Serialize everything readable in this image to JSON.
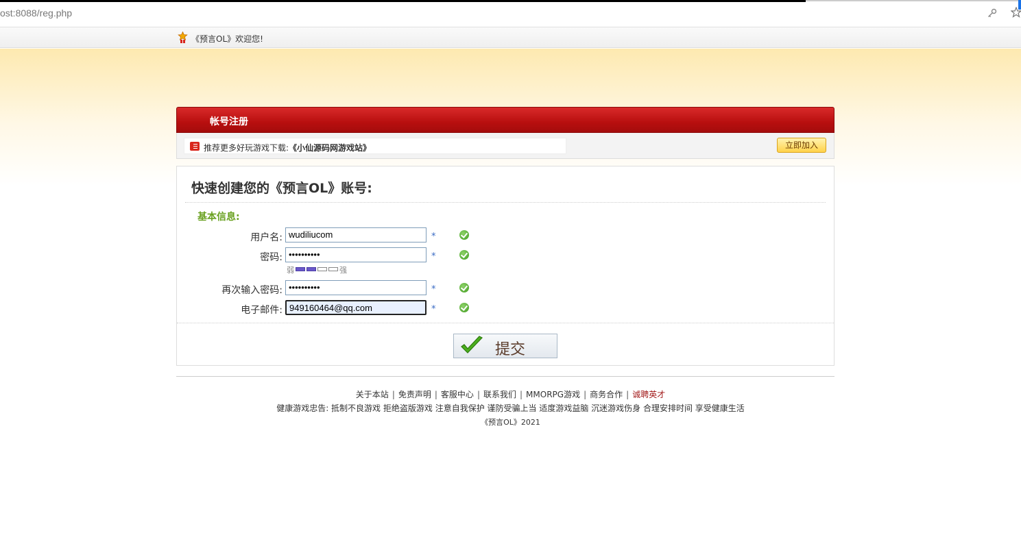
{
  "browser": {
    "url": "ost:8088/reg.php",
    "key_icon": "key-icon",
    "star_icon": "star-icon"
  },
  "topbar": {
    "welcome": "《预言OL》欢迎您!"
  },
  "register": {
    "header_title": "帐号注册",
    "recommend_prefix": "推荐更多好玩游戏下载:",
    "recommend_link": "《小仙源码网游戏站》",
    "join_button": "立即加入"
  },
  "form": {
    "heading": "快速创建您的《预言OL》账号:",
    "section": "基本信息:",
    "fields": [
      {
        "label": "用户名:",
        "value": "wudiliucom",
        "required": "*"
      },
      {
        "label": "密码:",
        "value": "••••••••••",
        "required": "*"
      },
      {
        "label": "再次输入密码:",
        "value": "••••••••••",
        "required": "*"
      },
      {
        "label": "电子邮件:",
        "value": "949160464@qq.com",
        "required": "*"
      }
    ],
    "strength_weak": "弱",
    "strength_strong": "强",
    "strength_level": 0.5,
    "submit_label": "提交"
  },
  "footer": {
    "links": [
      "关于本站",
      "免责声明",
      "客服中心",
      "联系我们",
      "MMORPG游戏",
      "商务合作",
      "诚聘英才"
    ],
    "sep": "|",
    "advice": "健康游戏忠告: 抵制不良游戏 拒绝盗版游戏 注意自我保护 谨防受骗上当 适度游戏益脑 沉迷游戏伤身 合理安排时间 享受健康生活",
    "copyright": "《预言OL》2021"
  },
  "colors": {
    "header_red": "#c41818",
    "section_green": "#6aa121",
    "hot_link": "#a21a1a"
  }
}
